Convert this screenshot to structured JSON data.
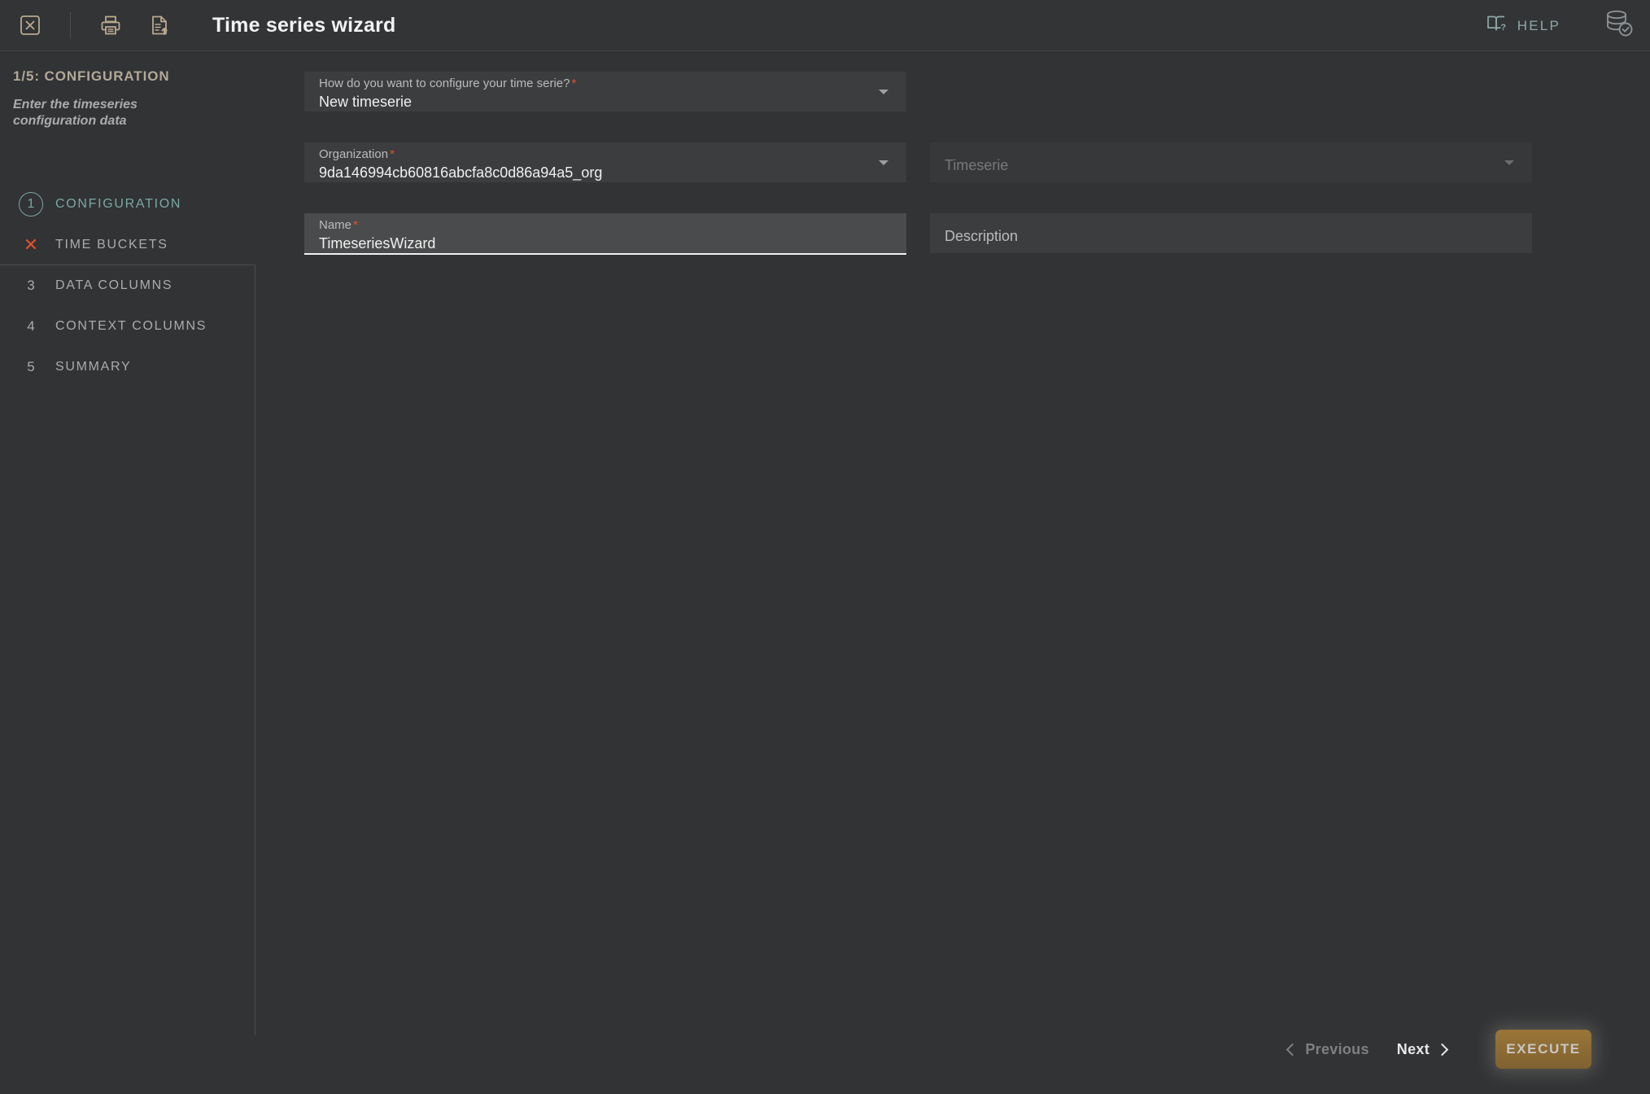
{
  "header": {
    "title": "Time series wizard",
    "close_icon": "close-box-icon",
    "print_icon": "printer-icon",
    "export_icon": "document-upload-icon",
    "help_label": "HELP",
    "help_icon": "book-question-icon",
    "database_icon": "database-check-icon"
  },
  "sidebar": {
    "step_title": "1/5: CONFIGURATION",
    "step_description": "Enter the timeseries configuration data",
    "steps": [
      {
        "marker": "1",
        "label": "CONFIGURATION",
        "state": "active",
        "marker_type": "circle-number"
      },
      {
        "marker": "✕",
        "label": "TIME BUCKETS",
        "state": "error",
        "marker_type": "x-mark"
      },
      {
        "marker": "3",
        "label": "DATA COLUMNS",
        "state": "pending",
        "marker_type": "number"
      },
      {
        "marker": "4",
        "label": "CONTEXT COLUMNS",
        "state": "pending",
        "marker_type": "number"
      },
      {
        "marker": "5",
        "label": "SUMMARY",
        "state": "pending",
        "marker_type": "number"
      }
    ]
  },
  "form": {
    "configure_mode": {
      "label": "How do you want to configure your time serie?",
      "required": "*",
      "value": "New timeserie"
    },
    "organization": {
      "label": "Organization",
      "required": "*",
      "value": "9da146994cb60816abcfa8c0d86a94a5_org"
    },
    "timeserie": {
      "placeholder": "Timeserie",
      "value": ""
    },
    "name": {
      "label": "Name",
      "required": "*",
      "value": "TimeseriesWizard"
    },
    "description": {
      "placeholder": "Description",
      "value": ""
    }
  },
  "footer": {
    "previous_label": "Previous",
    "next_label": "Next",
    "execute_label": "EXECUTE"
  },
  "colors": {
    "background": "#313335",
    "field": "#3b3d3f",
    "field_focused": "#4a4b4c",
    "accent_teal": "#7ba8a4",
    "accent_tan": "#b3a897",
    "error_red": "#e0512a",
    "execute_gold": "#9a7537"
  }
}
